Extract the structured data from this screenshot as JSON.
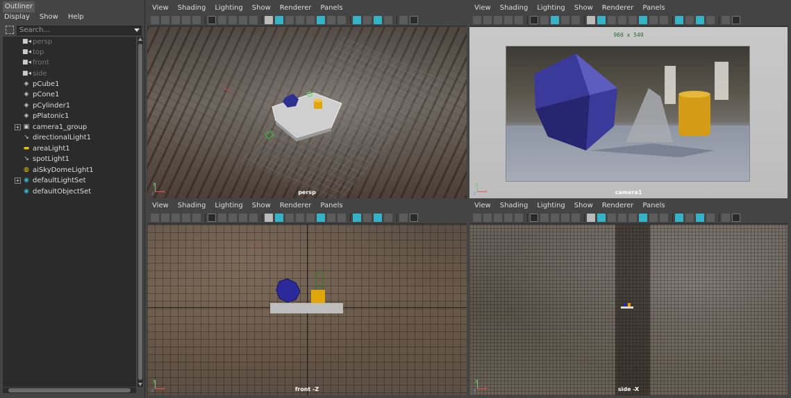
{
  "outliner": {
    "tab": "Outliner",
    "menu": [
      "Display",
      "Show",
      "Help"
    ],
    "search_placeholder": "Search...",
    "items": [
      {
        "label": "persp",
        "icon": "camera-icon",
        "dim": true
      },
      {
        "label": "top",
        "icon": "camera-icon",
        "dim": true
      },
      {
        "label": "front",
        "icon": "camera-icon",
        "dim": true
      },
      {
        "label": "side",
        "icon": "camera-icon",
        "dim": true
      },
      {
        "label": "pCube1",
        "icon": "mesh-icon",
        "dim": false
      },
      {
        "label": "pCone1",
        "icon": "mesh-icon",
        "dim": false
      },
      {
        "label": "pCylinder1",
        "icon": "mesh-icon",
        "dim": false
      },
      {
        "label": "pPlatonic1",
        "icon": "mesh-icon",
        "dim": false
      },
      {
        "label": "camera1_group",
        "icon": "camera-group-icon",
        "dim": false,
        "expand": "+"
      },
      {
        "label": "directionalLight1",
        "icon": "directional-light-icon",
        "dim": false
      },
      {
        "label": "areaLight1",
        "icon": "area-light-icon",
        "dim": false
      },
      {
        "label": "spotLight1",
        "icon": "spot-light-icon",
        "dim": false
      },
      {
        "label": "aiSkyDomeLight1",
        "icon": "skydome-light-icon",
        "dim": false
      },
      {
        "label": "defaultLightSet",
        "icon": "set-icon",
        "dim": false,
        "expand": "+"
      },
      {
        "label": "defaultObjectSet",
        "icon": "set-icon",
        "dim": false
      }
    ]
  },
  "viewport_menu": [
    "View",
    "Shading",
    "Lighting",
    "Show",
    "Renderer",
    "Panels"
  ],
  "viewports": {
    "persp": {
      "name": "persp"
    },
    "camera": {
      "name": "camera1",
      "resolution": "960 x 540"
    },
    "front": {
      "name": "front -Z"
    },
    "side": {
      "name": "side -X"
    }
  },
  "axis": {
    "x": "x",
    "y": "y",
    "z": "z"
  },
  "colors": {
    "accent": "#35b4c8",
    "platonic": "#2f2f8f",
    "cylinder": "#e2a60d",
    "panel_bg": "#444444"
  }
}
